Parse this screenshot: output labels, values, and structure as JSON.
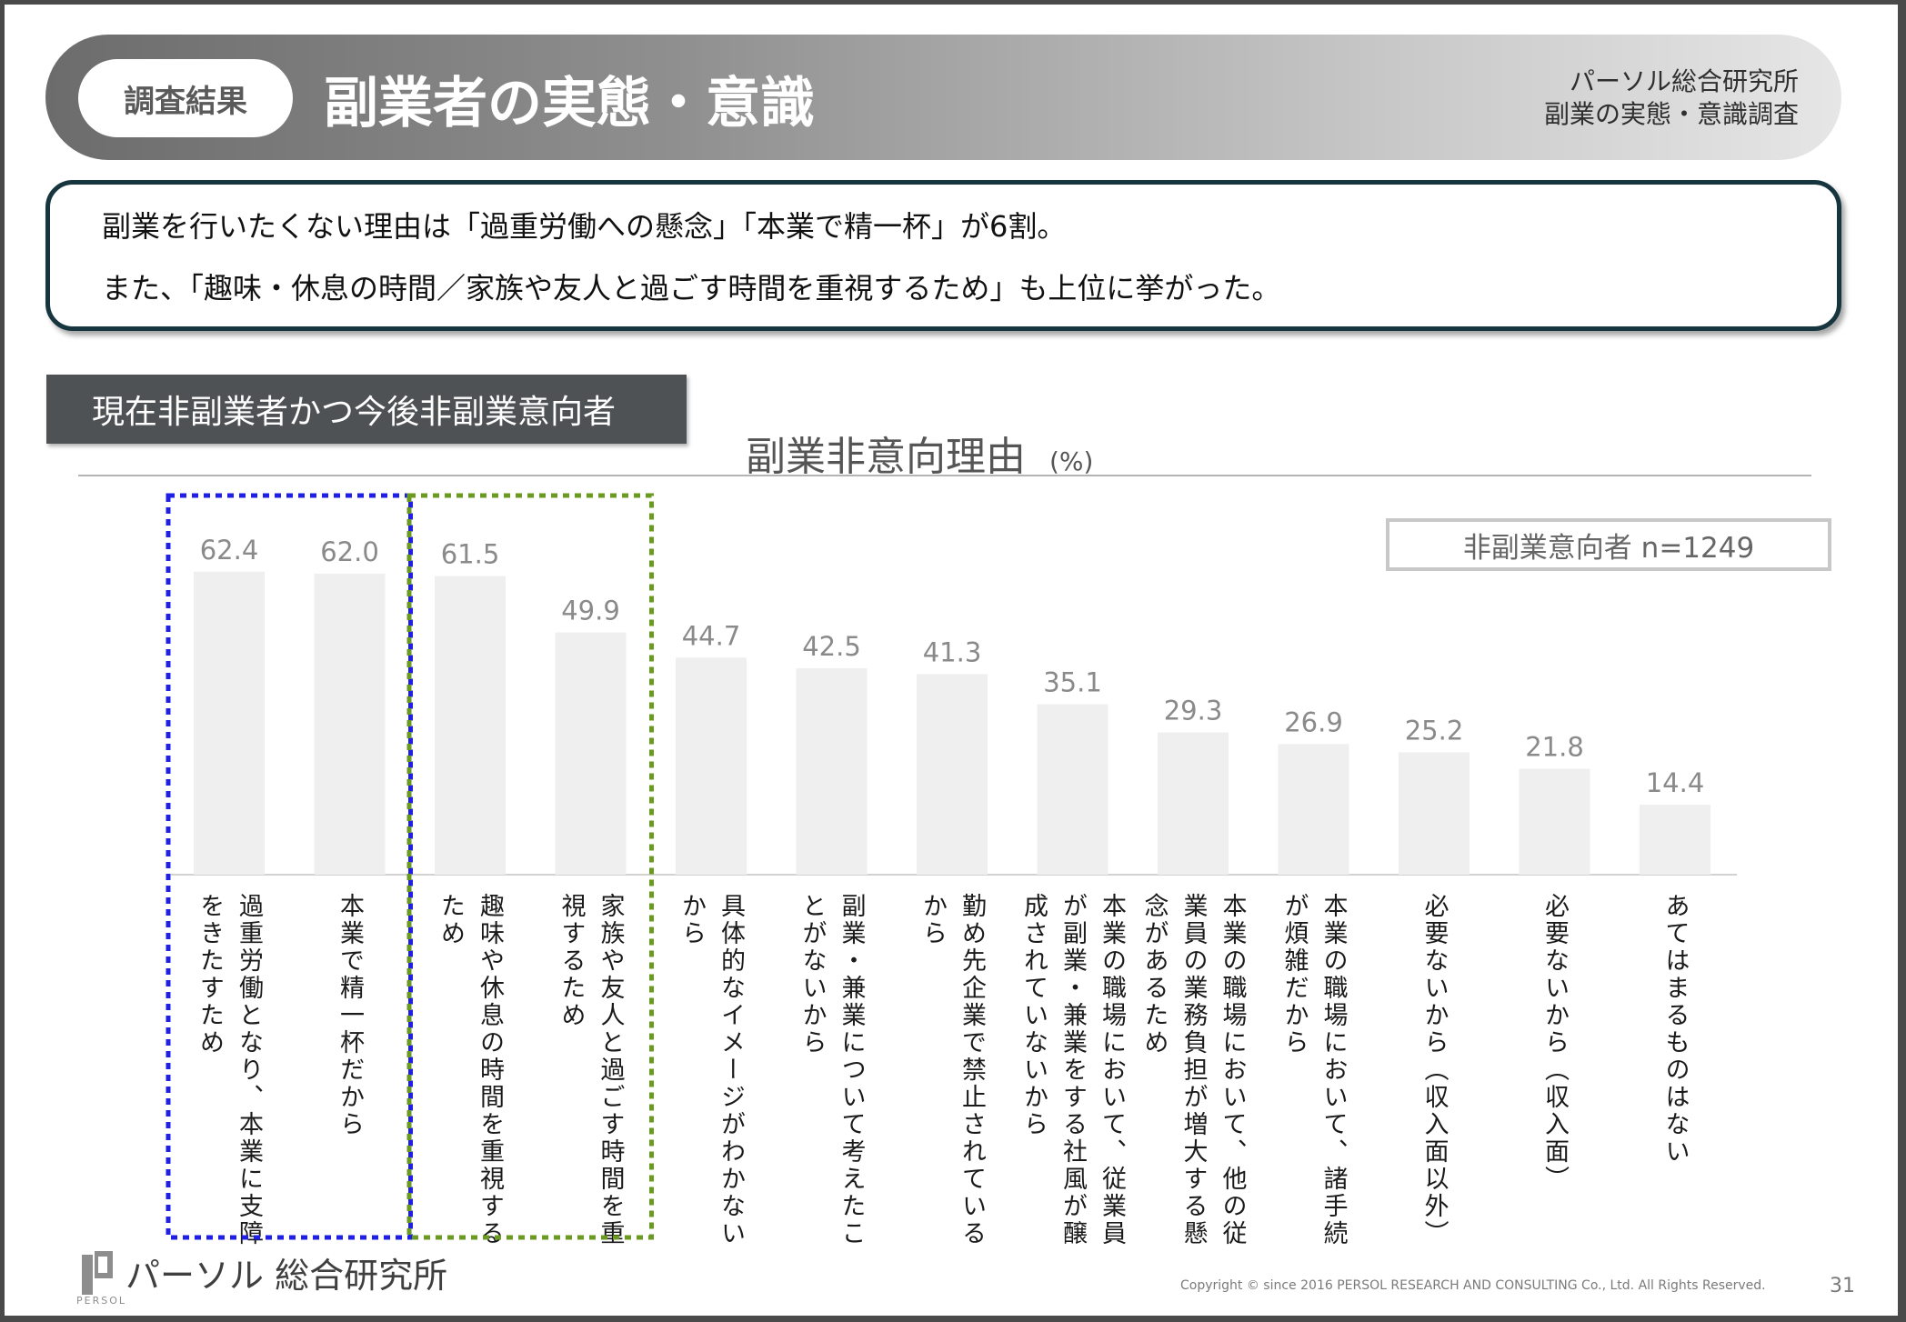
{
  "header": {
    "badge": "調査結果",
    "title": "副業者の実態・意識",
    "org_line1": "パーソル総合研究所",
    "org_line2": "副業の実態・意識調査"
  },
  "summary": {
    "line1": "副業を行いたくない理由は「過重労働への懸念」「本業で精一杯」が6割。",
    "line2": "また、「趣味・休息の時間／家族や友人と過ごす時間を重視するため」も上位に挙がった。"
  },
  "segment_label": "現在非副業者かつ今後非副業意向者",
  "chart_data": {
    "type": "bar",
    "title": "副業非意向理由",
    "unit": "(%)",
    "sample": "非副業意向者 n=1249",
    "ylim": [
      0,
      100
    ],
    "categories": [
      "過重労働となり、本業に支障をきたすため",
      "本業で精一杯だから",
      "趣味や休息の時間を重視するため",
      "家族や友人と過ごす時間を重視するため",
      "具体的なイメージがわかないから",
      "副業・兼業について考えたことがないから",
      "勤め先企業で禁止されているから",
      "本業の職場において、従業員が副業・兼業をする社風が醸成されていないから",
      "本業の職場において、他の従業員の業務負担が増大する懸念があるため",
      "本業の職場において、諸手続が煩雑だから",
      "必要ないから（収入面以外）",
      "必要ないから（収入面）",
      "あてはまるものはない"
    ],
    "label_columns": [
      [
        "過重労働となり、本業に支障",
        "をきたすため"
      ],
      [
        "本業で精一杯だから"
      ],
      [
        "趣味や休息の時間を重視する",
        "ため"
      ],
      [
        "家族や友人と過ごす時間を重",
        "視するため"
      ],
      [
        "具体的なイメージがわかない",
        "から"
      ],
      [
        "副業・兼業について考えたこ",
        "とがないから"
      ],
      [
        "勤め先企業で禁止されている",
        "から"
      ],
      [
        "本業の職場において、従業員",
        "が副業・兼業をする社風が醸",
        "成されていないから"
      ],
      [
        "本業の職場において、他の従",
        "業員の業務負担が増大する懸",
        "念があるため"
      ],
      [
        "本業の職場において、諸手続",
        "が煩雑だから"
      ],
      [
        "必要ないから（収入面以外）"
      ],
      [
        "必要ないから（収入面）"
      ],
      [
        "あてはまるものはない"
      ]
    ],
    "values": [
      62.4,
      62.0,
      61.5,
      49.9,
      44.7,
      42.5,
      41.3,
      35.1,
      29.3,
      26.9,
      25.2,
      21.8,
      14.4
    ],
    "value_labels": [
      "62.4",
      "62.0",
      "61.5",
      "49.9",
      "44.7",
      "42.5",
      "41.3",
      "35.1",
      "29.3",
      "26.9",
      "25.2",
      "21.8",
      "14.4"
    ],
    "highlight_groups": [
      {
        "indices": [
          0,
          1
        ],
        "color": "#1f1fe6"
      },
      {
        "indices": [
          2,
          3
        ],
        "color": "#6a9a1f"
      }
    ],
    "bar_color": "#efefef",
    "label_color": "#8a8a8a"
  },
  "footer": {
    "logo_text": "パーソル 総合研究所",
    "logo_sub": "PERSOL",
    "copyright": "Copyright © since 2016 PERSOL RESEARCH AND CONSULTING Co., Ltd. All Rights Reserved.",
    "page": "31"
  }
}
